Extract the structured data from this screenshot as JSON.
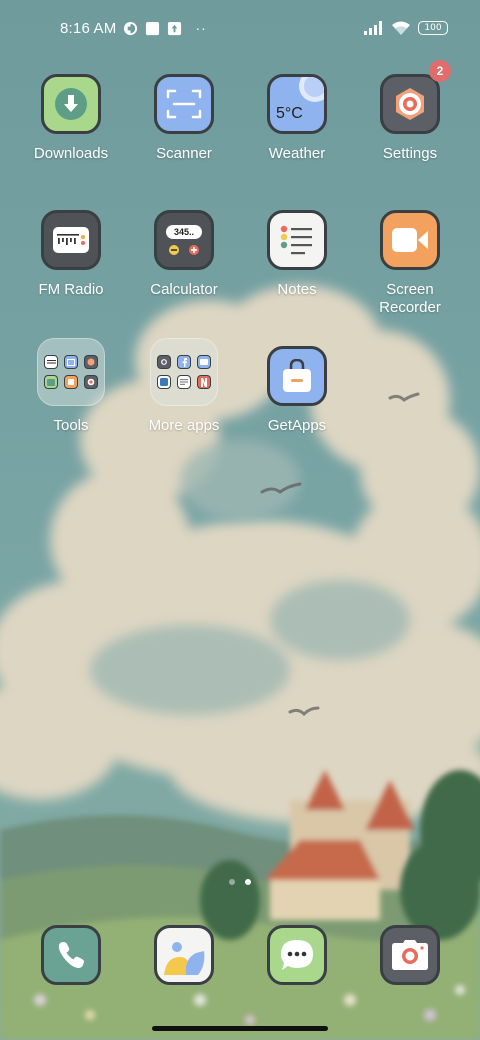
{
  "status_bar": {
    "time": "8:16 AM",
    "battery": "100",
    "indicators": [
      "data-saver-icon",
      "square-notification-icon",
      "upload-notification-icon",
      "more-notifications-dots"
    ],
    "dots": "··"
  },
  "apps": {
    "downloads": {
      "label": "Downloads",
      "color": "#a9d88c",
      "icon": "download-arrow"
    },
    "scanner": {
      "label": "Scanner",
      "color": "#8fb3ee",
      "icon": "scan-frame"
    },
    "weather": {
      "label": "Weather",
      "color": "#8fb3ee",
      "icon": "weather",
      "temp": "5°C"
    },
    "settings": {
      "label": "Settings",
      "color": "#5c6066",
      "icon": "gear",
      "badge": "2"
    },
    "fm_radio": {
      "label": "FM Radio",
      "color": "#4f5358",
      "icon": "radio"
    },
    "calculator": {
      "label": "Calculator",
      "color": "#4f5358",
      "icon": "calculator",
      "display": "345.."
    },
    "notes": {
      "label": "Notes",
      "color": "#f4f4f2",
      "icon": "checklist"
    },
    "screen_recorder": {
      "label": "Screen\nRecorder",
      "color": "#f2a25e",
      "icon": "video-camera"
    },
    "tools": {
      "label": "Tools"
    },
    "more_apps": {
      "label": "More apps"
    },
    "getapps": {
      "label": "GetApps",
      "color": "#8fb3ee",
      "icon": "shopping-bag"
    }
  },
  "dock": {
    "phone": {
      "color": "#6aa394",
      "icon": "phone-handset"
    },
    "gallery": {
      "color": "#f4f4f2",
      "icon": "gallery"
    },
    "messages": {
      "color": "#a9d88c",
      "icon": "chat-bubble"
    },
    "camera": {
      "color": "#5c6066",
      "icon": "camera"
    }
  },
  "page_indicator": {
    "pages": 2,
    "current": 2
  }
}
